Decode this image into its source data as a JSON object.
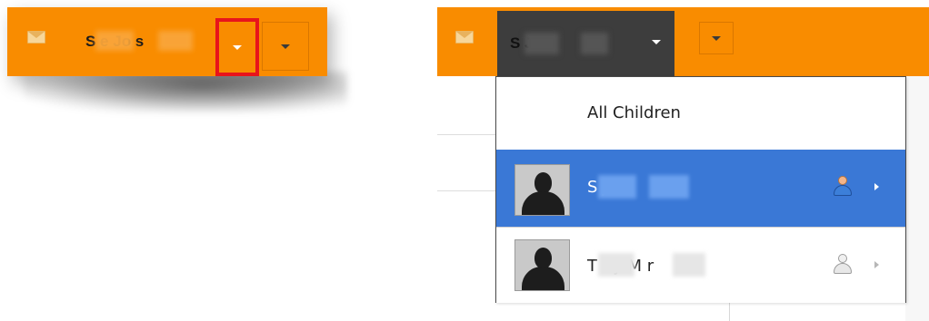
{
  "left_header": {
    "user_name": "S   e Jo  s",
    "highlighted_dropdown_icon": "caret-down-icon",
    "secondary_dropdown_icon": "caret-down-icon",
    "mail_icon": "envelope-icon"
  },
  "right_header": {
    "user_name": "S   J   s",
    "mail_icon": "envelope-icon",
    "dropdown_icon": "caret-down-icon"
  },
  "child_menu": {
    "all_label": "All Children",
    "items": [
      {
        "name": "S     J    s",
        "selected": true,
        "icon": "person-icon"
      },
      {
        "name": "T     ny M     r",
        "selected": false,
        "icon": "person-icon"
      }
    ]
  },
  "colors": {
    "header_orange": "#f98c00",
    "selected_blue": "#3a78d6",
    "highlight_red": "#e8141b",
    "user_tab_dark": "#3d3d3d"
  }
}
